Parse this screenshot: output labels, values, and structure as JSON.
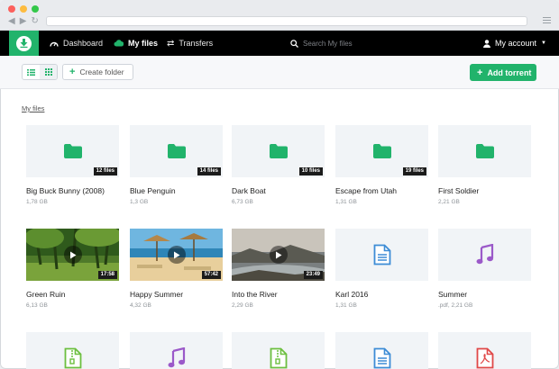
{
  "nav": {
    "dashboard": "Dashboard",
    "my_files": "My files",
    "transfers": "Transfers",
    "search_placeholder": "Search My files",
    "account": "My account"
  },
  "toolbar": {
    "create_folder": "Create folder",
    "add_torrent": "Add torrent"
  },
  "breadcrumb": "My files",
  "colors": {
    "brand": "#21b36b",
    "doc": "#3d8cd6",
    "audio": "#9b59c9",
    "archive": "#6cbf3f",
    "pdf": "#e04848"
  },
  "files": [
    {
      "name": "Big Buck Bunny (2008)",
      "meta": "1,78 GB",
      "type": "folder",
      "badge": "12 files"
    },
    {
      "name": "Blue Penguin",
      "meta": "1,3 GB",
      "type": "folder",
      "badge": "14 files"
    },
    {
      "name": "Dark Boat",
      "meta": "6,73 GB",
      "type": "folder",
      "badge": "10 files"
    },
    {
      "name": "Escape from Utah",
      "meta": "1,31 GB",
      "type": "folder",
      "badge": "19 files"
    },
    {
      "name": "First Soldier",
      "meta": "2,21 GB",
      "type": "folder",
      "badge": ""
    },
    {
      "name": "Green Ruin",
      "meta": "6,13 GB",
      "type": "video-forest",
      "badge": "17:58"
    },
    {
      "name": "Happy Summer",
      "meta": "4,32 GB",
      "type": "video-beach",
      "badge": "57:42"
    },
    {
      "name": "Into the River",
      "meta": "2,29 GB",
      "type": "video-river",
      "badge": "23:49"
    },
    {
      "name": "Karl 2016",
      "meta": "1,31 GB",
      "type": "document",
      "badge": ""
    },
    {
      "name": "Summer",
      "meta": ".pdf, 2,21 GB",
      "type": "audio",
      "badge": ""
    },
    {
      "name": "",
      "meta": "",
      "type": "archive",
      "badge": ""
    },
    {
      "name": "",
      "meta": "",
      "type": "audio",
      "badge": ""
    },
    {
      "name": "",
      "meta": "",
      "type": "archive",
      "badge": ""
    },
    {
      "name": "",
      "meta": "",
      "type": "document",
      "badge": ""
    },
    {
      "name": "",
      "meta": "",
      "type": "pdf",
      "badge": ""
    }
  ]
}
